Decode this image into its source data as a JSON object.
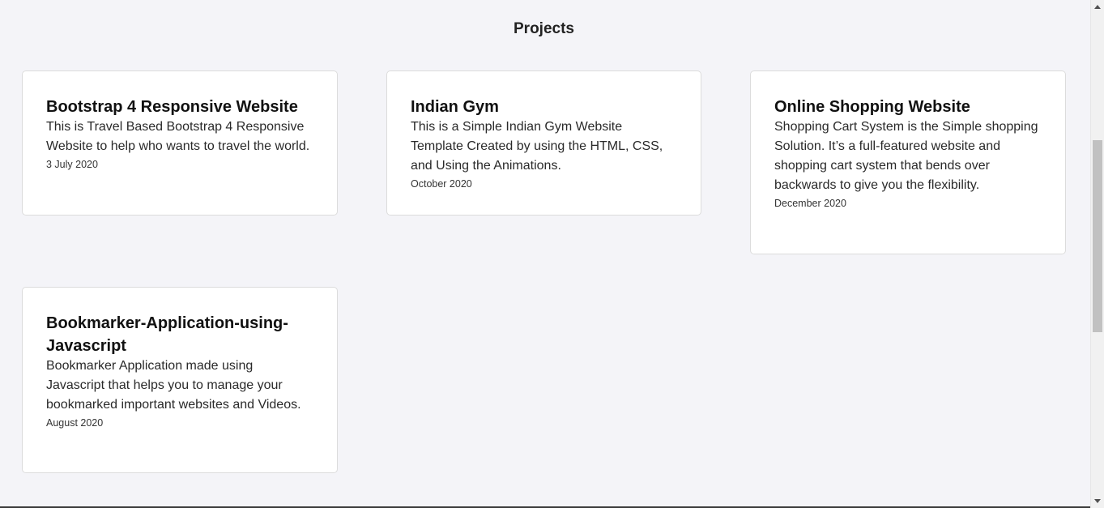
{
  "section": {
    "title": "Projects"
  },
  "projects": [
    {
      "title": "Bootstrap 4 Responsive Website",
      "description": "This is Travel Based Bootstrap 4 Responsive Website to help who wants to travel the world.",
      "date": "3 July 2020"
    },
    {
      "title": "Indian Gym",
      "description": "This is a Simple Indian Gym Website Template Created by using the HTML, CSS, and Using the Animations.",
      "date": "October 2020"
    },
    {
      "title": "Online Shopping Website",
      "description": "Shopping Cart System is the Simple shopping Solution. It’s a full-featured website and shopping cart system that bends over backwards to give you the flexibility.",
      "date": "December 2020"
    },
    {
      "title": "Bookmarker-Application-using-Javascript",
      "description": "Bookmarker Application made using Javascript that helps you to manage your bookmarked important websites and Videos.",
      "date": "August 2020"
    }
  ],
  "scrollbar": {
    "up_icon": "triangle-up-icon",
    "down_icon": "triangle-down-icon",
    "position_fraction": 0.28
  }
}
